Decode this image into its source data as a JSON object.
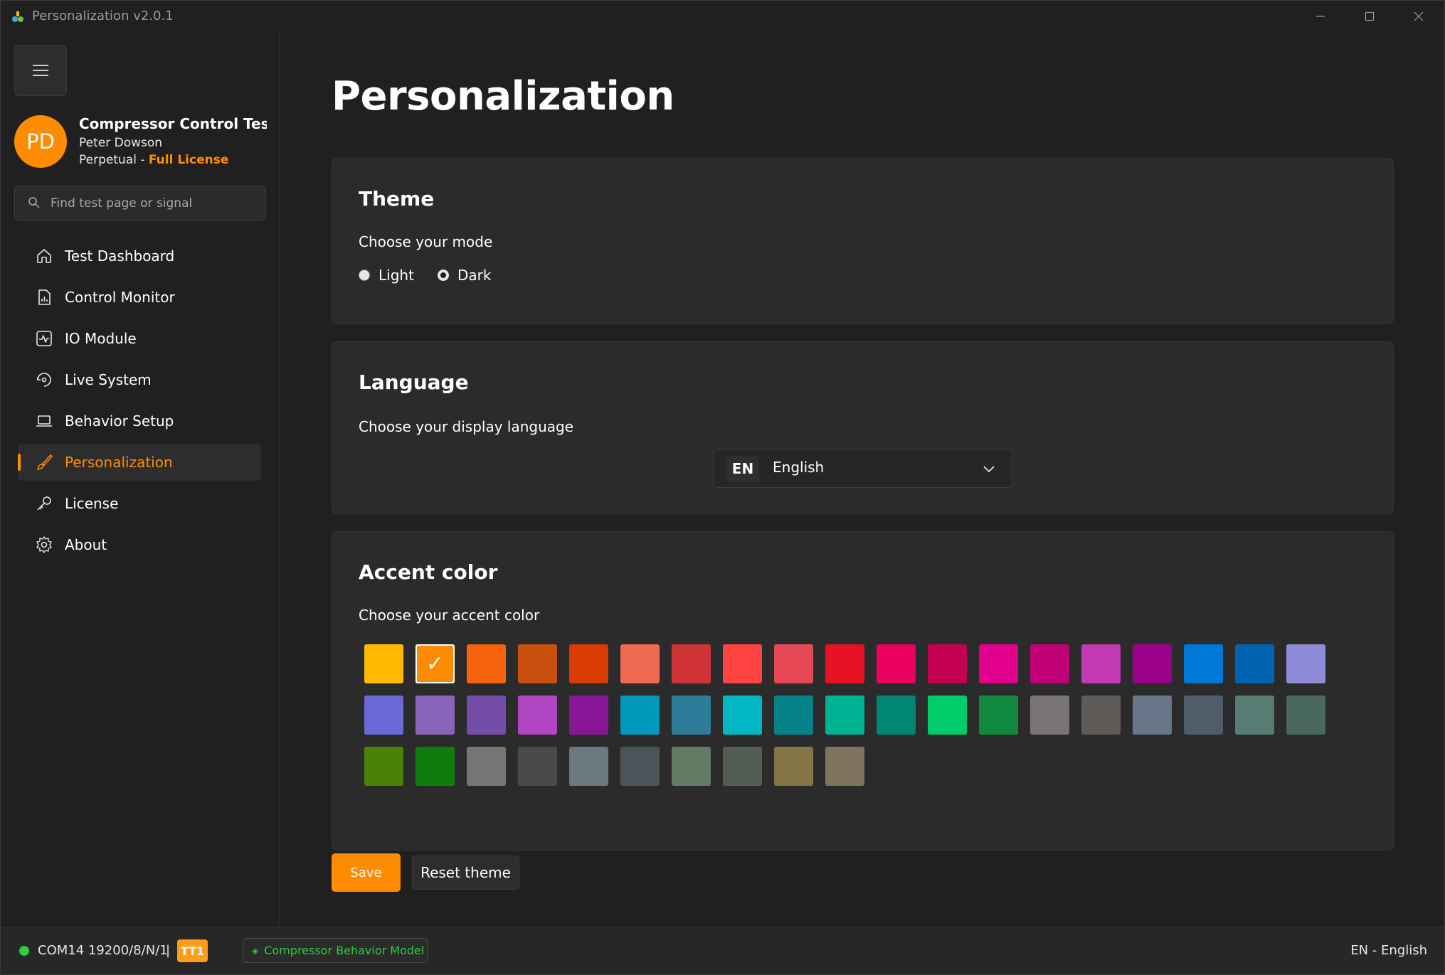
{
  "window": {
    "title": "Personalization v2.0.1"
  },
  "sidebar": {
    "menu_icon": "hamburger-icon",
    "profile": {
      "initials": "PD",
      "product": "Compressor Control Test Sir",
      "user": "Peter Dowson",
      "license_type": "Perpetual",
      "license_separator": " - ",
      "license_level": "Full License"
    },
    "search": {
      "placeholder": "Find test page or signal",
      "value": ""
    },
    "items": [
      {
        "label": "Test Dashboard",
        "icon": "home-icon",
        "active": false
      },
      {
        "label": "Control Monitor",
        "icon": "report-document-icon",
        "active": false
      },
      {
        "label": "IO Module",
        "icon": "pulse-monitor-icon",
        "active": false
      },
      {
        "label": "Live System",
        "icon": "sync-refresh-icon",
        "active": false
      },
      {
        "label": "Behavior Setup",
        "icon": "laptop-icon",
        "active": false
      },
      {
        "label": "Personalization",
        "icon": "paintbrush-icon",
        "active": true
      },
      {
        "label": "License",
        "icon": "key-icon",
        "active": false
      },
      {
        "label": "About",
        "icon": "gear-icon",
        "active": false
      }
    ]
  },
  "main": {
    "title": "Personalization",
    "theme": {
      "title": "Theme",
      "subtitle": "Choose your mode",
      "options": [
        {
          "label": "Light",
          "selected": false
        },
        {
          "label": "Dark",
          "selected": true
        }
      ]
    },
    "language": {
      "title": "Language",
      "subtitle": "Choose your display language",
      "selected_code": "EN",
      "selected_name": "English"
    },
    "accent": {
      "title": "Accent color",
      "subtitle": "Choose your accent color",
      "selected_index": 1,
      "check_glyph": "✓",
      "colors": [
        "#FFB900",
        "#FF8C00",
        "#F7630C",
        "#CA5010",
        "#DA3B01",
        "#EF6950",
        "#D13438",
        "#FF4343",
        "#E74856",
        "#E81123",
        "#EA005E",
        "#C30052",
        "#E3008C",
        "#BF0077",
        "#C239B3",
        "#9A0089",
        "#0078D7",
        "#0063B1",
        "#8E8CD8",
        "#6B69D6",
        "#8764B8",
        "#744DA9",
        "#B146C2",
        "#881798",
        "#0099BC",
        "#2D7D9A",
        "#00B7C3",
        "#038387",
        "#00B294",
        "#018574",
        "#00CC6A",
        "#10893E",
        "#7A7574",
        "#5D5A58",
        "#68768A",
        "#515C6B",
        "#567C73",
        "#486860",
        "#498205",
        "#107C10",
        "#767676",
        "#4C4A48",
        "#69797E",
        "#4A5459",
        "#647C64",
        "#525E54",
        "#847545",
        "#7E735F"
      ]
    },
    "buttons": {
      "save": "Save",
      "reset": "Reset theme"
    }
  },
  "statusbar": {
    "port": "COM14 19200/8/N/1",
    "separator": "|",
    "badge": "TT1",
    "model": "Compressor Behavior Model",
    "model_icon": "diamond-icon",
    "language": "EN - English",
    "connection_color": "#2ECC40"
  }
}
